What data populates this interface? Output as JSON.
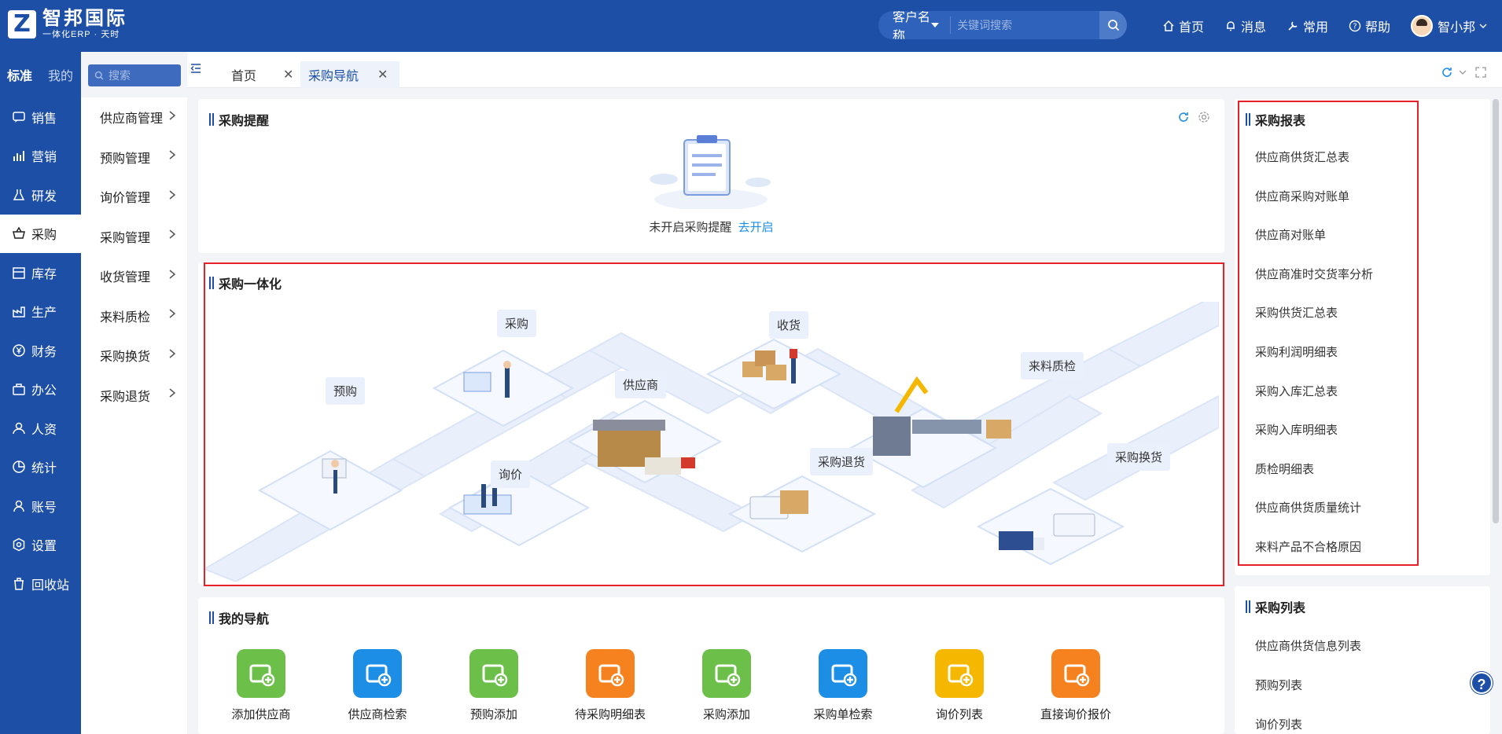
{
  "header": {
    "logo_mark": "Z",
    "logo_name": "智邦国际",
    "logo_sub": "一体化ERP · 天时",
    "search_type": "客户名称",
    "search_placeholder": "关键词搜索",
    "nav": [
      "首页",
      "消息",
      "常用",
      "帮助"
    ],
    "user_name": "智小邦"
  },
  "sidebar": {
    "tab_standard": "标准",
    "tab_mine": "我的",
    "search_placeholder": "搜索",
    "items": [
      {
        "label": "销售",
        "icon": "chat-icon"
      },
      {
        "label": "营销",
        "icon": "bar-chart-icon"
      },
      {
        "label": "研发",
        "icon": "flask-icon"
      },
      {
        "label": "采购",
        "icon": "basket-icon",
        "active": true
      },
      {
        "label": "库存",
        "icon": "warehouse-icon"
      },
      {
        "label": "生产",
        "icon": "factory-icon"
      },
      {
        "label": "财务",
        "icon": "yen-icon"
      },
      {
        "label": "办公",
        "icon": "briefcase-icon"
      },
      {
        "label": "人资",
        "icon": "person-icon"
      },
      {
        "label": "统计",
        "icon": "pie-chart-icon"
      },
      {
        "label": "账号",
        "icon": "user-icon"
      },
      {
        "label": "设置",
        "icon": "settings-icon"
      },
      {
        "label": "回收站",
        "icon": "trash-icon"
      }
    ]
  },
  "submenu": [
    "供应商管理",
    "预购管理",
    "询价管理",
    "采购管理",
    "收货管理",
    "来料质检",
    "采购换货",
    "采购退货"
  ],
  "tabs": [
    {
      "label": "首页",
      "active": false
    },
    {
      "label": "采购导航",
      "active": true
    }
  ],
  "reminder": {
    "title": "采购提醒",
    "message": "未开启采购提醒",
    "action": "去开启"
  },
  "integration": {
    "title": "采购一体化",
    "labels": {
      "prepurchase": "预购",
      "purchase": "采购",
      "supplier": "供应商",
      "inquiry": "询价",
      "receiving": "收货",
      "return": "采购退货",
      "qc": "来料质检",
      "exchange": "采购换货"
    }
  },
  "reports": {
    "title": "采购报表",
    "items": [
      "供应商供货汇总表",
      "供应商采购对账单",
      "供应商对账单",
      "供应商准时交货率分析",
      "采购供货汇总表",
      "采购利润明细表",
      "采购入库汇总表",
      "采购入库明细表",
      "质检明细表",
      "供应商供货质量统计",
      "来料产品不合格原因"
    ]
  },
  "list": {
    "title": "采购列表",
    "items": [
      "供应商供货信息列表",
      "预购列表",
      "询价列表"
    ]
  },
  "mynav": {
    "title": "我的导航",
    "items": [
      {
        "label": "添加供应商",
        "color": "#6cc04a"
      },
      {
        "label": "供应商检索",
        "color": "#1d8ee6"
      },
      {
        "label": "预购添加",
        "color": "#6cc04a"
      },
      {
        "label": "待采购明细表",
        "color": "#f5821f"
      },
      {
        "label": "采购添加",
        "color": "#6cc04a"
      },
      {
        "label": "采购单检索",
        "color": "#1d8ee6"
      },
      {
        "label": "询价列表",
        "color": "#f5b700"
      },
      {
        "label": "直接询价报价",
        "color": "#f5821f"
      }
    ]
  },
  "help_label": "?"
}
